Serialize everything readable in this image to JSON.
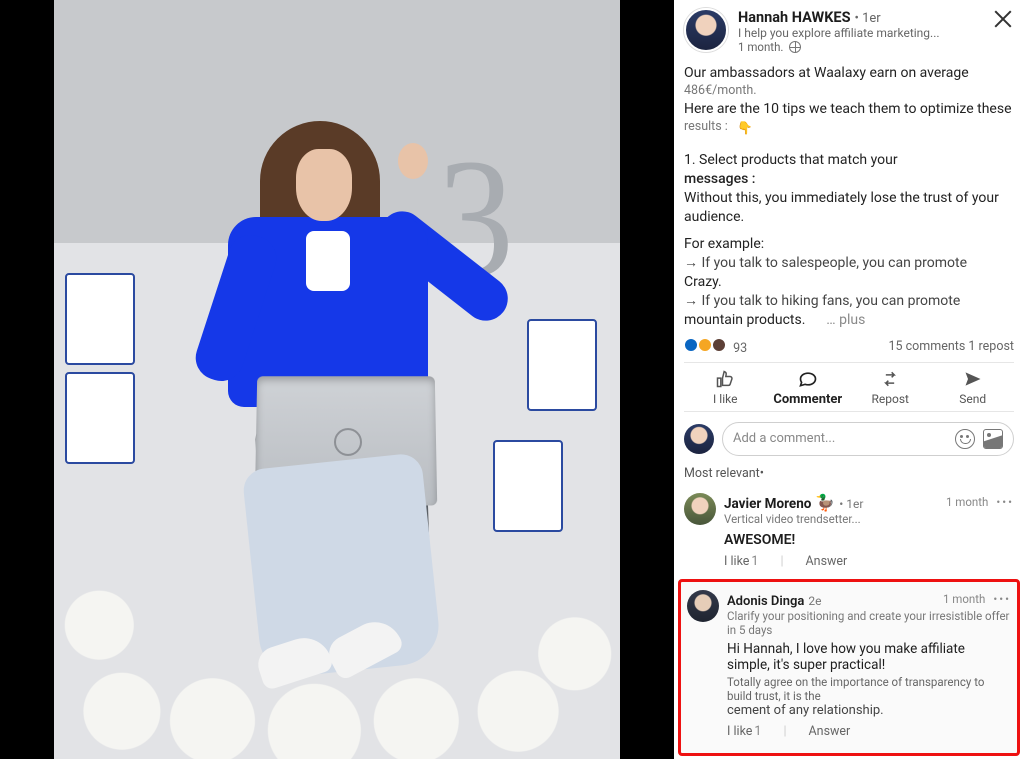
{
  "author": {
    "name": "Hannah HAWKES",
    "degree": "1er",
    "tagline": "I help you explore affiliate marketing...",
    "age": "1 month."
  },
  "post": {
    "l1": "Our ambassadors at Waalaxy earn on average",
    "l2": "486€/month.",
    "l3": "Here are the 10 tips we teach them to optimize these",
    "l4": "results :",
    "emoji": "👇",
    "p1a": "1. Select products that match your",
    "p1b": "messages :",
    "p1c": "Without this, you immediately lose the trust of your audience.",
    "ex": "For example:",
    "ex1": "→ If you talk to salespeople, you can promote",
    "ex1b": "Crazy.",
    "ex2": "→ If you talk to hiking fans, you can promote",
    "ex2b": "mountain products.",
    "more": "… plus"
  },
  "stats": {
    "reactions": "93",
    "comments": "15 comments",
    "reposts": "1 repost"
  },
  "actions": {
    "like": "I like",
    "comment": "Commenter",
    "repost": "Repost",
    "send": "Send"
  },
  "compose": {
    "placeholder": "Add a comment..."
  },
  "sort": "Most relevant•",
  "c1": {
    "name": "Javier Moreno",
    "badge": "🦆",
    "degree": "1er",
    "time": "1 month",
    "sub": "Vertical video trendsetter...",
    "text": "AWESOME!",
    "like": "I like",
    "liken": "1",
    "answer": "Answer"
  },
  "c2": {
    "name": "Adonis Dinga",
    "degree": "2e",
    "time": "1 month",
    "sub": "Clarify your positioning and create your irresistible offer in 5 days",
    "t1": "Hi Hannah, I love how you make affiliate simple, it's super practical!",
    "t2": "Totally agree on the importance of transparency to build trust, it is the",
    "t3": "cement of any relationship.",
    "like": "I like",
    "liken": "1",
    "answer": "Answer"
  }
}
